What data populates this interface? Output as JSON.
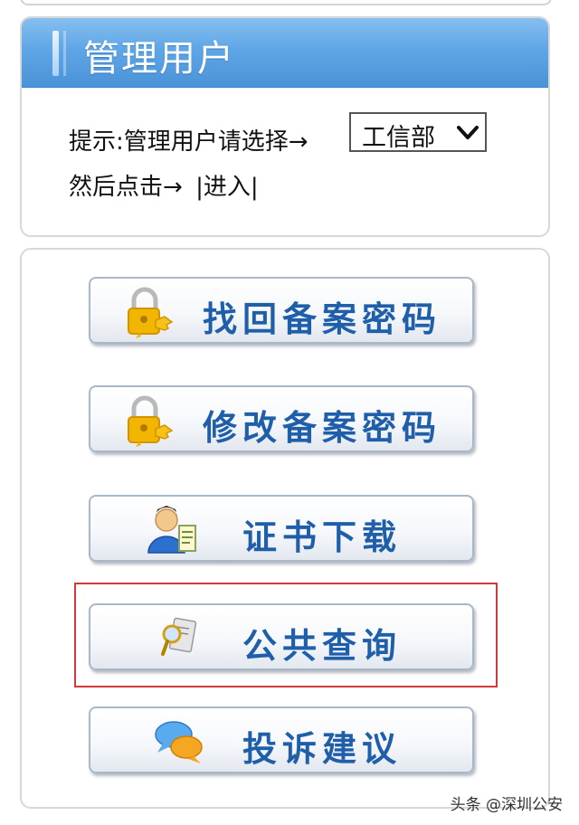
{
  "admin_panel": {
    "title": "管理用户",
    "tip_text": "提示:管理用户请选择→",
    "select_value": "工信部",
    "then_text": "然后点击→",
    "enter_link": "|进入|"
  },
  "buttons": [
    {
      "label": "找回备案密码",
      "icon": "lock-key-icon"
    },
    {
      "label": "修改备案密码",
      "icon": "lock-key-icon"
    },
    {
      "label": "证书下载",
      "icon": "user-certificate-icon"
    },
    {
      "label": "公共查询",
      "icon": "magnifier-document-icon"
    },
    {
      "label": "投诉建议",
      "icon": "chat-bubbles-icon"
    }
  ],
  "watermark": "头条 @深圳公安",
  "colors": {
    "header_blue": "#5fa6e6",
    "button_text": "#1f5faa",
    "highlight_red": "#d23a3a"
  }
}
